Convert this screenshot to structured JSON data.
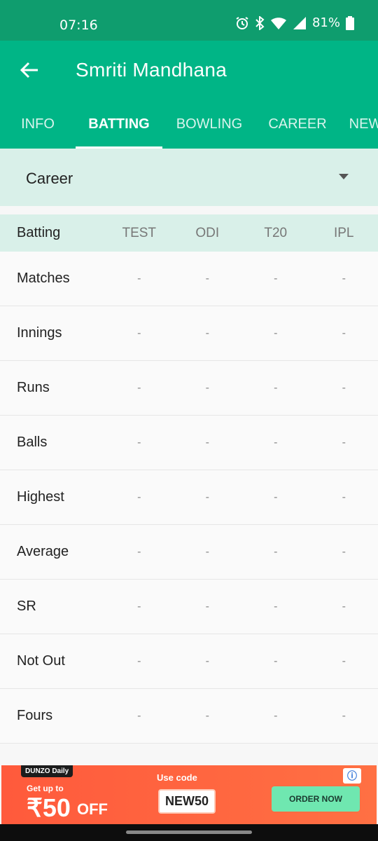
{
  "status_bar": {
    "time": "07:16",
    "battery": "81%"
  },
  "app_bar": {
    "title": "Smriti Mandhana",
    "tabs": [
      {
        "label": "INFO",
        "active": false
      },
      {
        "label": "BATTING",
        "active": true
      },
      {
        "label": "BOWLING",
        "active": false
      },
      {
        "label": "CAREER",
        "active": false
      },
      {
        "label": "NEW",
        "active": false
      }
    ]
  },
  "filter": {
    "selected": "Career"
  },
  "table": {
    "header_label": "Batting",
    "columns": [
      "TEST",
      "ODI",
      "T20",
      "IPL"
    ],
    "rows": [
      {
        "label": "Matches",
        "values": [
          "-",
          "-",
          "-",
          "-"
        ]
      },
      {
        "label": "Innings",
        "values": [
          "-",
          "-",
          "-",
          "-"
        ]
      },
      {
        "label": "Runs",
        "values": [
          "-",
          "-",
          "-",
          "-"
        ]
      },
      {
        "label": "Balls",
        "values": [
          "-",
          "-",
          "-",
          "-"
        ]
      },
      {
        "label": "Highest",
        "values": [
          "-",
          "-",
          "-",
          "-"
        ]
      },
      {
        "label": "Average",
        "values": [
          "-",
          "-",
          "-",
          "-"
        ]
      },
      {
        "label": "SR",
        "values": [
          "-",
          "-",
          "-",
          "-"
        ]
      },
      {
        "label": "Not Out",
        "values": [
          "-",
          "-",
          "-",
          "-"
        ]
      },
      {
        "label": "Fours",
        "values": [
          "-",
          "-",
          "-",
          "-"
        ]
      }
    ]
  },
  "ad": {
    "brand": "DUNZO Daily",
    "get_up_to": "Get up to",
    "amount": "₹50",
    "off": "OFF",
    "use_code": "Use code",
    "code": "NEW50",
    "cta": "ORDER NOW",
    "info": "ⓘ"
  },
  "colors": {
    "primary": "#00b586",
    "status_bar": "#0f9d6e",
    "light_accent": "#d9f0e9"
  }
}
